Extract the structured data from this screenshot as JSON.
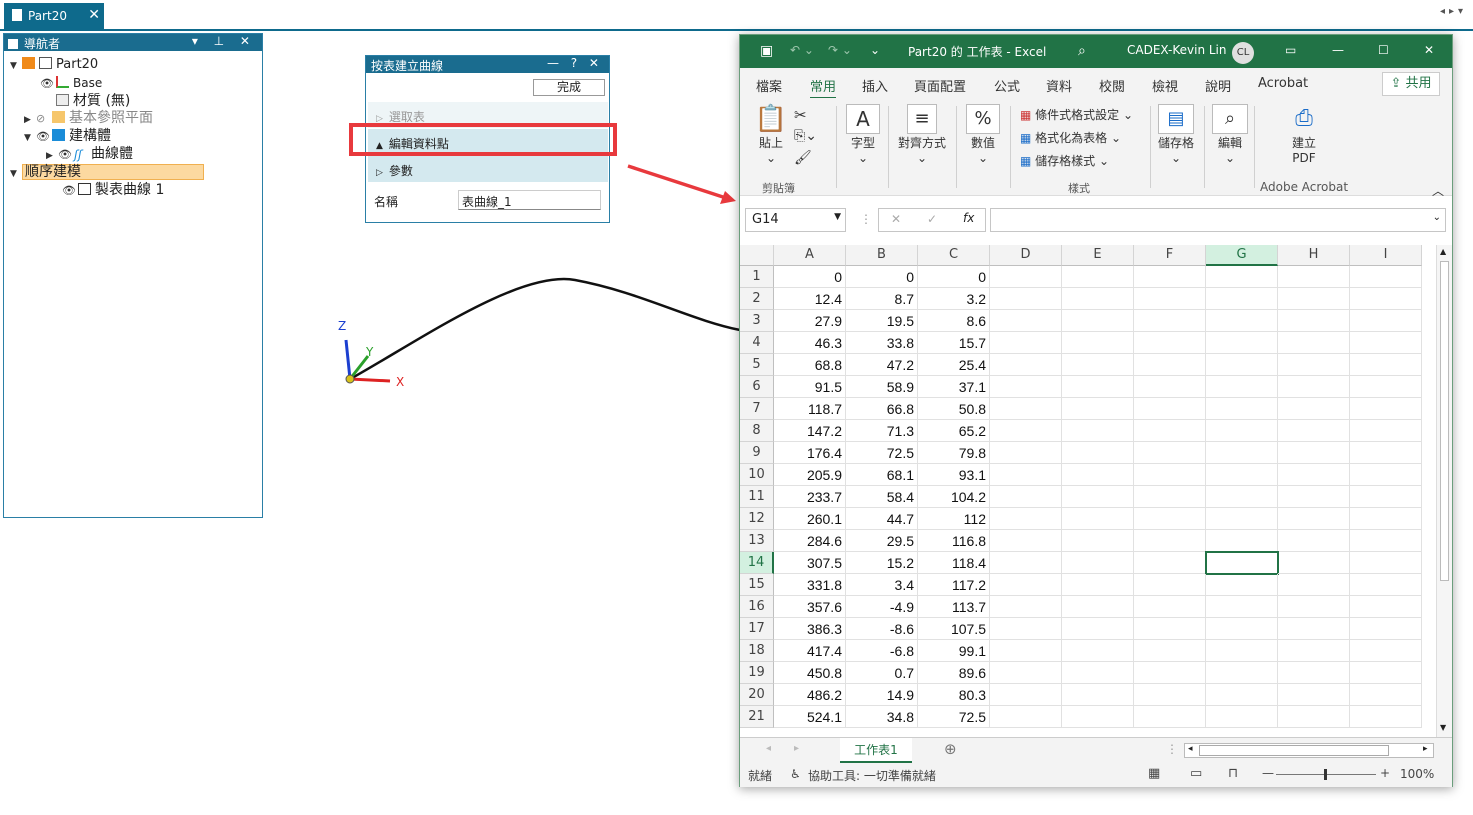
{
  "doc_tab": {
    "title": "Part20",
    "close": "✕"
  },
  "navigator": {
    "title": "導航者",
    "tree": [
      "Part20",
      "Base",
      "材質 (無)",
      "基本參照平面",
      "建構體",
      "曲線體",
      "順序建模",
      "製表曲線 1"
    ]
  },
  "dialog": {
    "title": "按表建立曲線",
    "done_label": "完成",
    "sections": [
      "選取表",
      "編輯資料點",
      "參數"
    ],
    "name_label": "名稱",
    "name_value": "表曲線_1"
  },
  "axes": {
    "x": "X",
    "y": "Y",
    "z": "Z"
  },
  "excel": {
    "title": "Part20 的 工作表 - Excel",
    "user": "CADEX-Kevin Lin",
    "avatar": "CL",
    "tabs": [
      "檔案",
      "常用",
      "插入",
      "頁面配置",
      "公式",
      "資料",
      "校閱",
      "檢視",
      "說明",
      "Acrobat"
    ],
    "share": "共用",
    "ribbon": {
      "paste": "貼上",
      "clipboard": "剪貼簿",
      "font": "字型",
      "alignment": "對齊方式",
      "number": "數值",
      "cond_format": "條件式格式設定",
      "format_table": "格式化為表格",
      "cell_styles": "儲存格樣式",
      "styles": "樣式",
      "cells": "儲存格",
      "editing": "編輯",
      "create_pdf_1": "建立",
      "create_pdf_2": "PDF",
      "adobe": "Adobe Acrobat"
    },
    "name_box": "G14",
    "columns": [
      "A",
      "B",
      "C",
      "D",
      "E",
      "F",
      "G",
      "H",
      "I"
    ],
    "rows": [
      [
        "0",
        "0",
        "0"
      ],
      [
        "12.4",
        "8.7",
        "3.2"
      ],
      [
        "27.9",
        "19.5",
        "8.6"
      ],
      [
        "46.3",
        "33.8",
        "15.7"
      ],
      [
        "68.8",
        "47.2",
        "25.4"
      ],
      [
        "91.5",
        "58.9",
        "37.1"
      ],
      [
        "118.7",
        "66.8",
        "50.8"
      ],
      [
        "147.2",
        "71.3",
        "65.2"
      ],
      [
        "176.4",
        "72.5",
        "79.8"
      ],
      [
        "205.9",
        "68.1",
        "93.1"
      ],
      [
        "233.7",
        "58.4",
        "104.2"
      ],
      [
        "260.1",
        "44.7",
        "112"
      ],
      [
        "284.6",
        "29.5",
        "116.8"
      ],
      [
        "307.5",
        "15.2",
        "118.4"
      ],
      [
        "331.8",
        "3.4",
        "117.2"
      ],
      [
        "357.6",
        "-4.9",
        "113.7"
      ],
      [
        "386.3",
        "-8.6",
        "107.5"
      ],
      [
        "417.4",
        "-6.8",
        "99.1"
      ],
      [
        "450.8",
        "0.7",
        "89.6"
      ],
      [
        "486.2",
        "14.9",
        "80.3"
      ],
      [
        "524.1",
        "34.8",
        "72.5"
      ]
    ],
    "sheet_name": "工作表1",
    "status_ready": "就緒",
    "accessibility": "協助工具: 一切準備就緒",
    "zoom": "100%"
  }
}
